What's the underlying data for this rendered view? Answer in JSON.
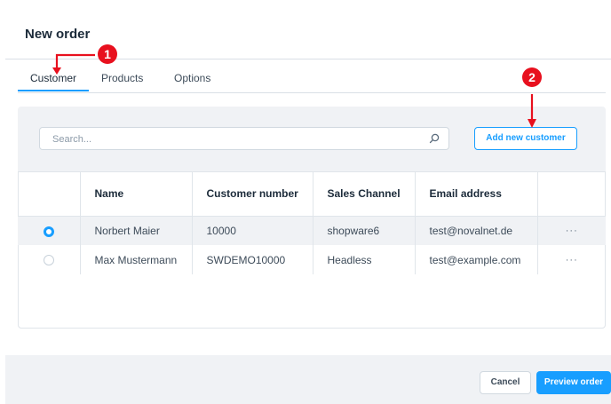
{
  "modal": {
    "title": "New order"
  },
  "tabs": [
    {
      "label": "Customer",
      "active": true
    },
    {
      "label": "Products",
      "active": false
    },
    {
      "label": "Options",
      "active": false
    }
  ],
  "search": {
    "placeholder": "Search..."
  },
  "add_customer_button": "Add new customer",
  "table": {
    "headers": [
      "",
      "Name",
      "Customer number",
      "Sales Channel",
      "Email address",
      ""
    ],
    "rows": [
      {
        "selected": true,
        "name": "Norbert Maier",
        "customer_number": "10000",
        "sales_channel": "shopware6",
        "email": "test@novalnet.de",
        "actions": "···"
      },
      {
        "selected": false,
        "name": "Max Mustermann",
        "customer_number": "SWDEMO10000",
        "sales_channel": "Headless",
        "email": "test@example.com",
        "actions": "···"
      }
    ]
  },
  "footer": {
    "cancel_label": "Cancel",
    "preview_label": "Preview order"
  },
  "annotations": [
    {
      "number": "1"
    },
    {
      "number": "2"
    }
  ],
  "colors": {
    "accent": "#189eff",
    "annotation": "#e8101e",
    "panel_bg": "#f0f2f5"
  }
}
